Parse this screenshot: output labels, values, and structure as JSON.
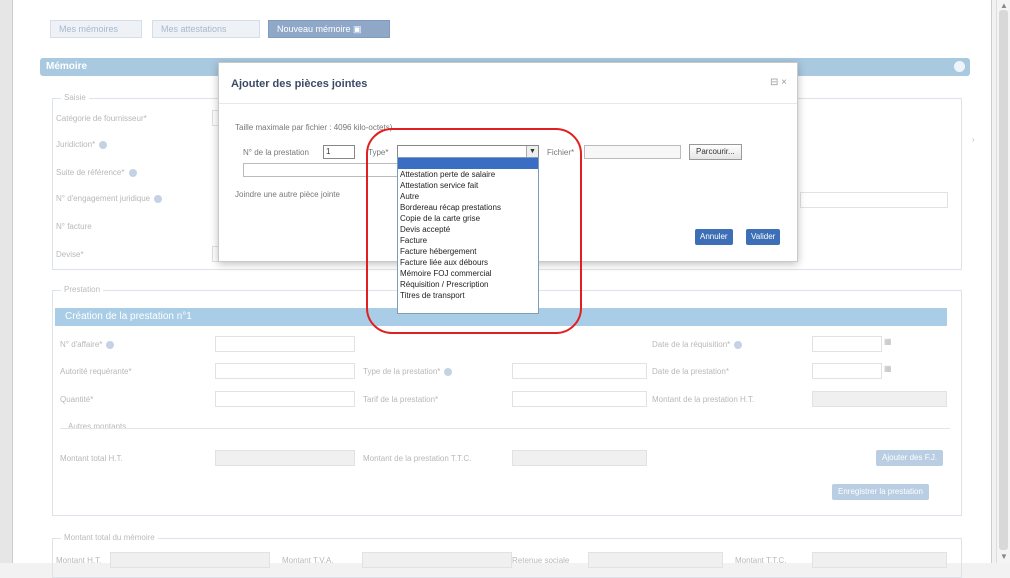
{
  "tabs": [
    "Mes mémoires",
    "Mes attestations",
    "Nouveau mémoire ▣"
  ],
  "section_title": "Mémoire",
  "form": {
    "saisie_legend": "Saisie",
    "labels": [
      "Catégorie de fournisseur*",
      "Juridiction*",
      "Suite de référence*",
      "N° d'engagement juridique",
      "N° facture",
      "Devise*"
    ],
    "prestation_legend": "Prestation",
    "prestation_title": "Création de la prestation n°1",
    "row_labels": {
      "num_affaire": "N° d'affaire*",
      "autorite": "Autorité requérante*",
      "type_prestation": "Type de la prestation*",
      "date_requisition": "Date de la réquisition*",
      "date_prestation": "Date de la prestation*",
      "quantite": "Quantité*",
      "tarif": "Tarif de la prestation*",
      "montant_ht": "Montant de la prestation H.T.",
      "autres_montants": "Autres montants",
      "montant_total_ht": "Montant total H.T.",
      "montant_ttc": "Montant de la prestation T.T.C.",
      "ajouter_frais": "Ajouter des F.J.",
      "enregistrer": "Enregistrer la prestation"
    },
    "montant_legend": "Montant total du mémoire",
    "bottom_labels": [
      "Montant H.T.",
      "Montant T.V.A.",
      "Retenue sociale",
      "Montant T.T.C."
    ]
  },
  "modal": {
    "title": "Ajouter des pièces jointes",
    "close": "⊟ ×",
    "max_size": "Taille maximale par fichier : 4096 kilo-octets)",
    "prestation_label": "N° de la prestation",
    "prestation_value": "1",
    "type_label": "Type*",
    "fichier_label": "Fichier*",
    "browse_button": "Parcourir...",
    "join_another": "Joindre une autre pièce jointe",
    "cancel_button": "Annuler",
    "validate_button": "Valider"
  },
  "dropdown_options": [
    "",
    "Attestation perte de salaire",
    "Attestation service fait",
    "Autre",
    "Bordereau récap prestations",
    "Copie de la carte grise",
    "Devis accepté",
    "Facture",
    "Facture hébergement",
    "Facture liée aux débours",
    "Mémoire FOJ commercial",
    "Réquisition / Prescription",
    "Titres de transport"
  ],
  "colors": {
    "annotation": "#e02020",
    "selected": "#3a6ec2",
    "accent": "#a9c9e0"
  }
}
